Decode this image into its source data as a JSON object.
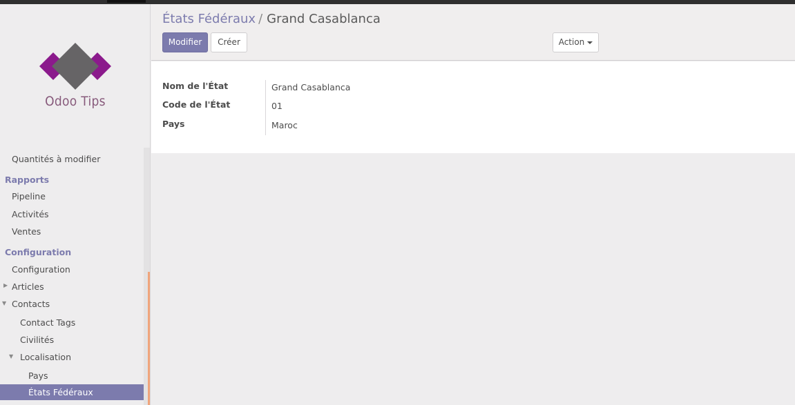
{
  "sidebar": {
    "logo_text": "Odoo Tips",
    "items": {
      "quantites": "Quantités à modifier",
      "rapports": "Rapports",
      "pipeline": "Pipeline",
      "activites": "Activités",
      "ventes": "Ventes",
      "configuration_header": "Configuration",
      "configuration": "Configuration",
      "articles": "Articles",
      "contacts": "Contacts",
      "contact_tags": "Contact Tags",
      "civilites": "Civilités",
      "localisation": "Localisation",
      "pays": "Pays",
      "etats": "États Fédéraux"
    }
  },
  "breadcrumb": {
    "parent": "États Fédéraux",
    "separator": "/",
    "current": "Grand Casablanca"
  },
  "toolbar": {
    "edit_label": "Modifier",
    "create_label": "Créer",
    "action_label": "Action"
  },
  "form": {
    "name_label": "Nom de l'État",
    "name_value": "Grand Casablanca",
    "code_label": "Code de l'État",
    "code_value": "01",
    "country_label": "Pays",
    "country_value": "Maroc"
  },
  "colors": {
    "accent": "#7c7bad",
    "brand": "#875a7b",
    "scroll_thumb": "#f0a57c"
  }
}
